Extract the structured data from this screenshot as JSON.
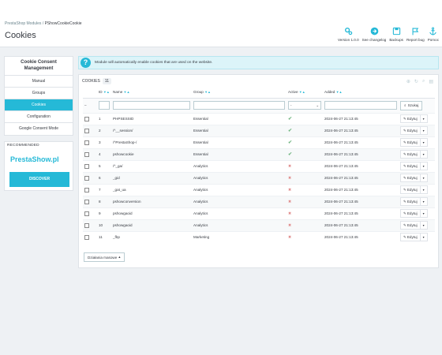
{
  "breadcrumb": {
    "parent": "PrestaShop Modules",
    "separator": "/",
    "current": "PShowCookieCookie"
  },
  "page_title": "Cookies",
  "toolbar": [
    {
      "label": "Version 1.0.0",
      "icon": "gears-icon"
    },
    {
      "label": "See changelog",
      "icon": "arrow-circle-icon"
    },
    {
      "label": "Backups",
      "icon": "save-icon"
    },
    {
      "label": "Report bug",
      "icon": "flag-icon"
    },
    {
      "label": "Pomoc",
      "icon": "anchor-icon"
    }
  ],
  "sidebar": {
    "title": "Cookie Consent Management",
    "items": [
      {
        "label": "Manual"
      },
      {
        "label": "Groups"
      },
      {
        "label": "Cookies"
      },
      {
        "label": "Configuration"
      },
      {
        "label": "Google Consent Mode"
      }
    ],
    "active_index": 2
  },
  "promo": {
    "heading": "RECOMMENDED",
    "brand": "PrestaShow.pl",
    "button": "DISCOVER"
  },
  "alert": {
    "icon": "question-icon",
    "text": "Module will automatically enable cookies that are used on the website."
  },
  "panel": {
    "title": "COOKIES",
    "count": "11",
    "columns": {
      "id": "ID",
      "name": "Name",
      "group": "Group",
      "active": "Active",
      "added": "Added"
    },
    "filter": {
      "active_placeholder": "-",
      "search_label": "Szukaj"
    },
    "rows": [
      {
        "id": "1",
        "name": "PHPSESSID",
        "group": "Essential",
        "active": true,
        "added": "2024-06-27 21:13:45"
      },
      {
        "id": "2",
        "name": "/^__session/",
        "group": "Essential",
        "active": true,
        "added": "2024-06-27 21:13:45"
      },
      {
        "id": "3",
        "name": "/^PrestaShop-/",
        "group": "Essential",
        "active": true,
        "added": "2024-06-27 21:13:45"
      },
      {
        "id": "4",
        "name": "pshowcookie",
        "group": "Essential",
        "active": true,
        "added": "2024-06-27 21:13:45"
      },
      {
        "id": "5",
        "name": "/^_ga/",
        "group": "Analytics",
        "active": false,
        "added": "2024-06-27 21:13:45"
      },
      {
        "id": "6",
        "name": "_gid",
        "group": "Analytics",
        "active": false,
        "added": "2024-06-27 21:13:45"
      },
      {
        "id": "7",
        "name": "_gat_ua",
        "group": "Analytics",
        "active": false,
        "added": "2024-06-27 21:13:45"
      },
      {
        "id": "8",
        "name": "pshowconversion",
        "group": "Analytics",
        "active": false,
        "added": "2024-06-27 21:13:45"
      },
      {
        "id": "9",
        "name": "pshowgaoid",
        "group": "Analytics",
        "active": false,
        "added": "2024-06-27 21:13:45"
      },
      {
        "id": "10",
        "name": "pshowgaoid",
        "group": "Analytics",
        "active": false,
        "added": "2024-06-27 21:13:45"
      },
      {
        "id": "11",
        "name": "_fbp",
        "group": "Marketing",
        "active": false,
        "added": "2024-06-27 21:13:45"
      }
    ],
    "row_action": "Edytuj",
    "bulk_label": "Działania masowe"
  },
  "colors": {
    "accent": "#25b9d7",
    "active": "#70b580",
    "inactive": "#e08b8b"
  }
}
